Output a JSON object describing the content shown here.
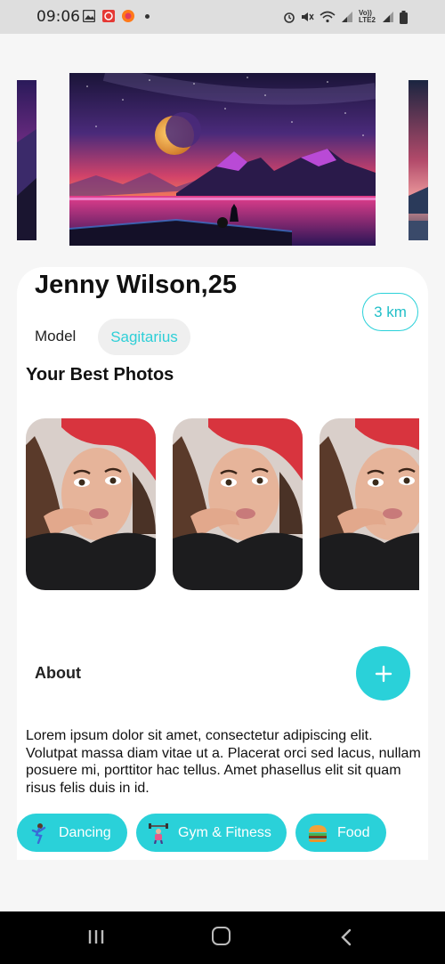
{
  "status_bar": {
    "time": "09:06",
    "left_icons": [
      "image-icon",
      "app-icon",
      "firefox-icon"
    ],
    "right_icons": [
      "alarm-icon",
      "mute-icon",
      "wifi-icon",
      "signal-icon",
      "volte-icon",
      "signal-icon-2",
      "battery-icon"
    ],
    "volte_label": "Vo)) LTE2"
  },
  "carousel": {
    "slides": [
      "space-landscape-left",
      "space-landscape-main",
      "space-landscape-right"
    ]
  },
  "profile": {
    "name": "Jenny Wilson,25",
    "distance": "3 km",
    "profession": "Model",
    "zodiac": "Sagitarius"
  },
  "photos": {
    "title": "Your Best Photos",
    "count_visible": 3
  },
  "about": {
    "title": "About",
    "text": "Lorem ipsum dolor sit amet, consectetur adipiscing elit. Volutpat massa diam vitae ut a. Placerat orci sed lacus, nullam posuere mi, porttitor hac tellus. Amet phasellus elit sit quam risus felis duis in id."
  },
  "interests": [
    {
      "label": "Dancing",
      "icon": "dancer-icon"
    },
    {
      "label": "Gym & Fitness",
      "icon": "weightlifter-icon"
    },
    {
      "label": "Food",
      "icon": "burger-icon"
    }
  ],
  "colors": {
    "accent": "#2ad1d9",
    "card_bg": "#ffffff",
    "page_bg": "#f6f6f6",
    "pill_bg": "#efefef"
  }
}
